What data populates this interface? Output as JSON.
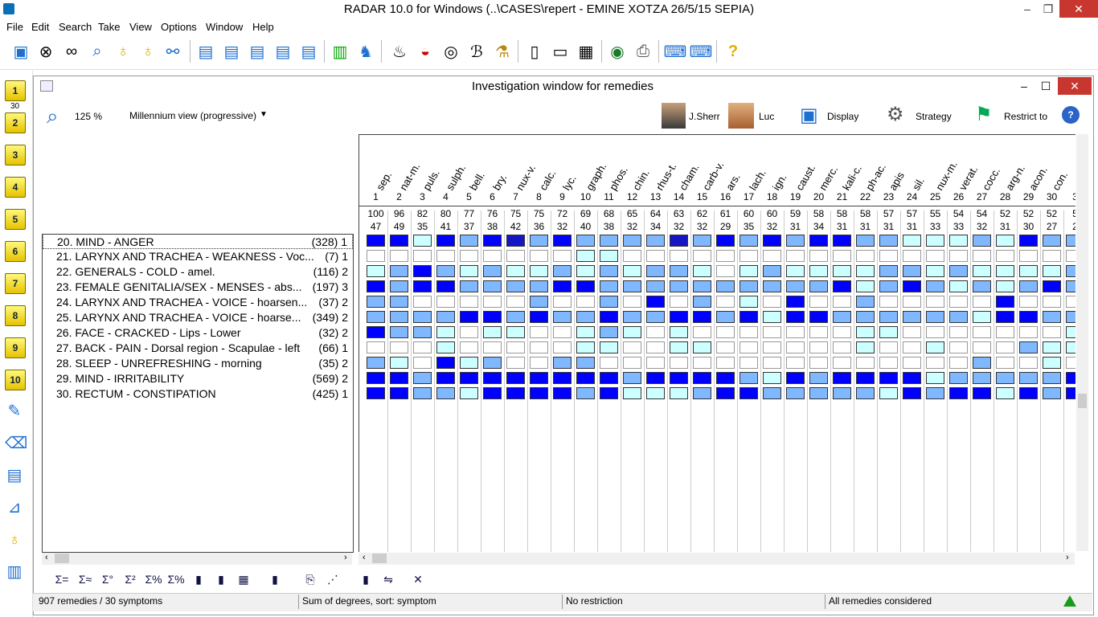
{
  "window": {
    "title": "RADAR 10.0 for Windows  (..\\CASES\\repert - EMINE  XOTZA  26/5/15  SEPIA)"
  },
  "menu": [
    "File",
    "Edit",
    "Search",
    "Take",
    "View",
    "Options",
    "Window",
    "Help"
  ],
  "sidebar_numbers": [
    "1",
    "2",
    "3",
    "4",
    "5",
    "6",
    "7",
    "8",
    "9",
    "10"
  ],
  "sidebar_badge": "30",
  "investigation": {
    "title": "Investigation window for remedies",
    "zoom": "125 %",
    "view_mode": "Millennium view (progressive)",
    "buttons": {
      "sherr": "J.Sherr",
      "luc": "Luc",
      "display": "Display",
      "strategy": "Strategy",
      "restrict": "Restrict to"
    }
  },
  "symptoms": [
    {
      "label": "20. MIND - ANGER",
      "count": "(328) 1"
    },
    {
      "label": "21. LARYNX AND TRACHEA - WEAKNESS - Voc...",
      "count": "(7) 1"
    },
    {
      "label": "22. GENERALS - COLD - amel.",
      "count": "(116) 2"
    },
    {
      "label": "23. FEMALE GENITALIA/SEX - MENSES - abs...",
      "count": "(197) 3"
    },
    {
      "label": "24. LARYNX AND TRACHEA - VOICE - hoarsen...",
      "count": "(37) 2"
    },
    {
      "label": "25. LARYNX AND TRACHEA - VOICE - hoarse...",
      "count": "(349) 2"
    },
    {
      "label": "26. FACE - CRACKED - Lips - Lower",
      "count": "(32) 2"
    },
    {
      "label": "27. BACK - PAIN - Dorsal region - Scapulae - left",
      "count": "(66) 1"
    },
    {
      "label": "28. SLEEP - UNREFRESHING - morning",
      "count": "(35) 2"
    },
    {
      "label": "29. MIND - IRRITABILITY",
      "count": "(569) 2"
    },
    {
      "label": "30. RECTUM - CONSTIPATION",
      "count": "(425) 1"
    }
  ],
  "remedies": [
    {
      "name": "sep.",
      "num": "1",
      "score": "100",
      "hits": "47"
    },
    {
      "name": "nat-m.",
      "num": "2",
      "score": "96",
      "hits": "49"
    },
    {
      "name": "puls.",
      "num": "3",
      "score": "82",
      "hits": "35"
    },
    {
      "name": "sulph.",
      "num": "4",
      "score": "80",
      "hits": "41"
    },
    {
      "name": "bell.",
      "num": "5",
      "score": "77",
      "hits": "37"
    },
    {
      "name": "bry.",
      "num": "6",
      "score": "76",
      "hits": "38"
    },
    {
      "name": "nux-v.",
      "num": "7",
      "score": "75",
      "hits": "42"
    },
    {
      "name": "calc.",
      "num": "8",
      "score": "75",
      "hits": "36"
    },
    {
      "name": "lyc.",
      "num": "9",
      "score": "72",
      "hits": "32"
    },
    {
      "name": "graph.",
      "num": "10",
      "score": "69",
      "hits": "40"
    },
    {
      "name": "phos.",
      "num": "11",
      "score": "68",
      "hits": "38"
    },
    {
      "name": "chin.",
      "num": "12",
      "score": "65",
      "hits": "32"
    },
    {
      "name": "rhus-t.",
      "num": "13",
      "score": "64",
      "hits": "34"
    },
    {
      "name": "cham.",
      "num": "14",
      "score": "63",
      "hits": "32"
    },
    {
      "name": "carb-v.",
      "num": "15",
      "score": "62",
      "hits": "32"
    },
    {
      "name": "ars.",
      "num": "16",
      "score": "61",
      "hits": "29"
    },
    {
      "name": "lach.",
      "num": "17",
      "score": "60",
      "hits": "35"
    },
    {
      "name": "ign.",
      "num": "18",
      "score": "60",
      "hits": "32"
    },
    {
      "name": "caust.",
      "num": "19",
      "score": "59",
      "hits": "31"
    },
    {
      "name": "merc.",
      "num": "20",
      "score": "58",
      "hits": "34"
    },
    {
      "name": "kali-c.",
      "num": "21",
      "score": "58",
      "hits": "31"
    },
    {
      "name": "ph-ac.",
      "num": "22",
      "score": "58",
      "hits": "31"
    },
    {
      "name": "apis",
      "num": "23",
      "score": "57",
      "hits": "31"
    },
    {
      "name": "sil.",
      "num": "24",
      "score": "57",
      "hits": "31"
    },
    {
      "name": "nux-m.",
      "num": "25",
      "score": "55",
      "hits": "33"
    },
    {
      "name": "verat.",
      "num": "26",
      "score": "54",
      "hits": "33"
    },
    {
      "name": "cocc.",
      "num": "27",
      "score": "54",
      "hits": "32"
    },
    {
      "name": "arg-n.",
      "num": "28",
      "score": "52",
      "hits": "31"
    },
    {
      "name": "acon.",
      "num": "29",
      "score": "52",
      "hits": "30"
    },
    {
      "name": "con.",
      "num": "30",
      "score": "52",
      "hits": "27"
    },
    {
      "name": "",
      "num": "3",
      "score": "5",
      "hits": "2"
    }
  ],
  "grades": [
    [
      3,
      3,
      1,
      3,
      2,
      3,
      4,
      2,
      3,
      2,
      2,
      2,
      2,
      4,
      2,
      3,
      2,
      3,
      2,
      3,
      3,
      2,
      2,
      1,
      1,
      1,
      2,
      1,
      3,
      2,
      2
    ],
    [
      0,
      0,
      0,
      0,
      0,
      0,
      0,
      0,
      0,
      1,
      1,
      0,
      0,
      0,
      0,
      0,
      0,
      0,
      0,
      0,
      0,
      0,
      0,
      0,
      0,
      0,
      0,
      0,
      0,
      0,
      0
    ],
    [
      1,
      2,
      3,
      2,
      1,
      2,
      1,
      1,
      2,
      1,
      2,
      1,
      2,
      2,
      1,
      0,
      1,
      2,
      1,
      1,
      1,
      1,
      2,
      2,
      1,
      2,
      1,
      1,
      1,
      1,
      2
    ],
    [
      3,
      2,
      3,
      3,
      2,
      2,
      2,
      2,
      3,
      3,
      2,
      2,
      2,
      2,
      2,
      2,
      2,
      2,
      2,
      2,
      3,
      1,
      2,
      3,
      2,
      1,
      2,
      1,
      2,
      3,
      2
    ],
    [
      2,
      2,
      0,
      0,
      0,
      0,
      0,
      2,
      0,
      0,
      2,
      0,
      3,
      0,
      2,
      0,
      1,
      0,
      3,
      0,
      0,
      2,
      0,
      0,
      0,
      0,
      0,
      3,
      0,
      0,
      0
    ],
    [
      2,
      2,
      2,
      2,
      3,
      3,
      2,
      3,
      2,
      2,
      3,
      2,
      2,
      3,
      3,
      2,
      3,
      1,
      3,
      3,
      2,
      2,
      2,
      2,
      2,
      2,
      1,
      3,
      3,
      2,
      2
    ],
    [
      3,
      2,
      2,
      1,
      0,
      1,
      1,
      0,
      0,
      1,
      2,
      1,
      0,
      1,
      0,
      0,
      0,
      0,
      0,
      0,
      0,
      1,
      1,
      0,
      0,
      0,
      0,
      0,
      0,
      0,
      1
    ],
    [
      0,
      0,
      0,
      1,
      0,
      0,
      0,
      0,
      0,
      1,
      1,
      0,
      0,
      1,
      1,
      0,
      0,
      0,
      0,
      0,
      0,
      1,
      0,
      0,
      1,
      0,
      0,
      0,
      2,
      1,
      1
    ],
    [
      2,
      1,
      0,
      3,
      1,
      2,
      0,
      0,
      2,
      2,
      0,
      0,
      0,
      0,
      0,
      0,
      0,
      0,
      0,
      0,
      0,
      0,
      0,
      0,
      0,
      0,
      2,
      0,
      0,
      1,
      0
    ],
    [
      3,
      3,
      2,
      3,
      3,
      3,
      3,
      3,
      3,
      3,
      3,
      2,
      3,
      3,
      3,
      3,
      2,
      1,
      3,
      2,
      3,
      3,
      3,
      3,
      1,
      2,
      2,
      2,
      2,
      2,
      3
    ],
    [
      3,
      3,
      2,
      2,
      1,
      3,
      3,
      3,
      3,
      2,
      3,
      1,
      1,
      1,
      2,
      3,
      3,
      2,
      2,
      2,
      2,
      2,
      1,
      3,
      2,
      3,
      3,
      1,
      3,
      2,
      3
    ]
  ],
  "colors": {
    "grade1": "#ccffff",
    "grade2": "#7fb8ff",
    "grade3": "#0000ff",
    "grade4": "#1616c4",
    "grade0": "#ffffff",
    "close": "#c7372f"
  },
  "status": {
    "remedies": "907 remedies / 30 symptoms",
    "sort": "Sum of degrees, sort: symptom",
    "restriction": "No restriction",
    "considered": "All remedies considered"
  },
  "toolbar_icons": [
    "new-case-icon",
    "binoculars-icon",
    "glasses-icon",
    "magnifier-icon",
    "bulb-icon",
    "bulb-plus-icon",
    "link-icon",
    "take-1-icon",
    "take-2-icon",
    "take-3-icon",
    "take-4-icon",
    "take-5-icon",
    "chart-icon",
    "person-icon",
    "fire-icon",
    "rainbow-icon",
    "lifebuoy-icon",
    "spiral-icon",
    "flask-icon",
    "book-icon",
    "open-book-icon",
    "document-icon",
    "globe-icon",
    "printer-icon",
    "keyboard-icon",
    "network-icon",
    "help-icon"
  ],
  "bottom_icons": [
    "Σ=",
    "Σ≈",
    "Σ°",
    "Σ²",
    "Σ%",
    "Σ%",
    "▮",
    "▮",
    "▦",
    "▮",
    "⎘",
    "⋰",
    "▮",
    "⇋",
    "✕"
  ]
}
